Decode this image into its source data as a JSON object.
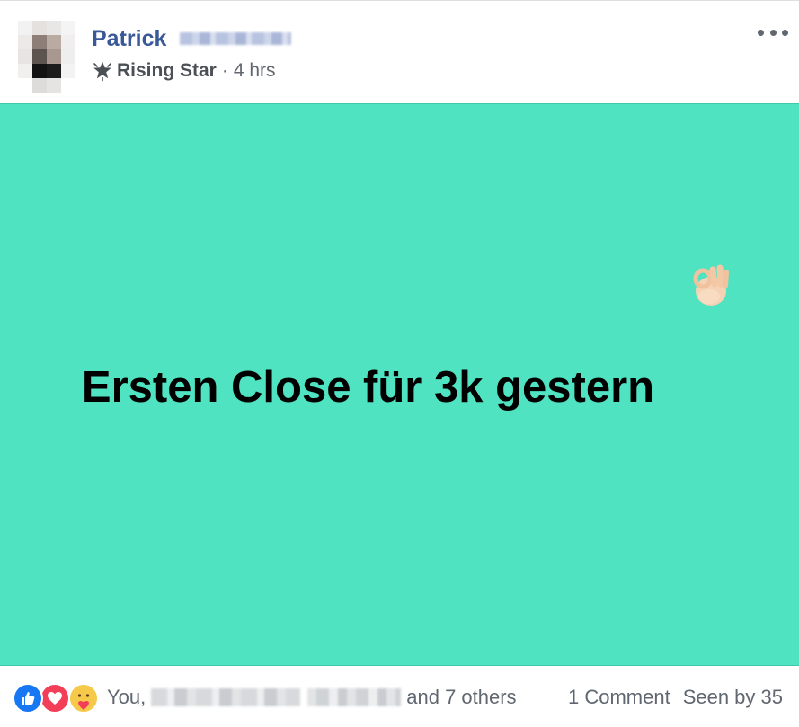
{
  "author": {
    "name": "Patrick",
    "badge": "Rising Star",
    "separator": "·",
    "time": "4 hrs"
  },
  "post": {
    "text": "Ersten Close für 3k gestern",
    "background_color": "#50e3c2",
    "emoji_icon": "ok-hand-icon"
  },
  "footer": {
    "reaction_icons": [
      "like-icon",
      "love-icon",
      "care-icon"
    ],
    "likers_prefix": "You,",
    "likers_suffix": "and 7 others",
    "comments": "1 Comment",
    "seen": "Seen by 35"
  },
  "colors": {
    "author_name": "#385898",
    "meta_text": "#606770",
    "like": "#1877f2",
    "love": "#f33e58",
    "care": "#f7c94a"
  }
}
